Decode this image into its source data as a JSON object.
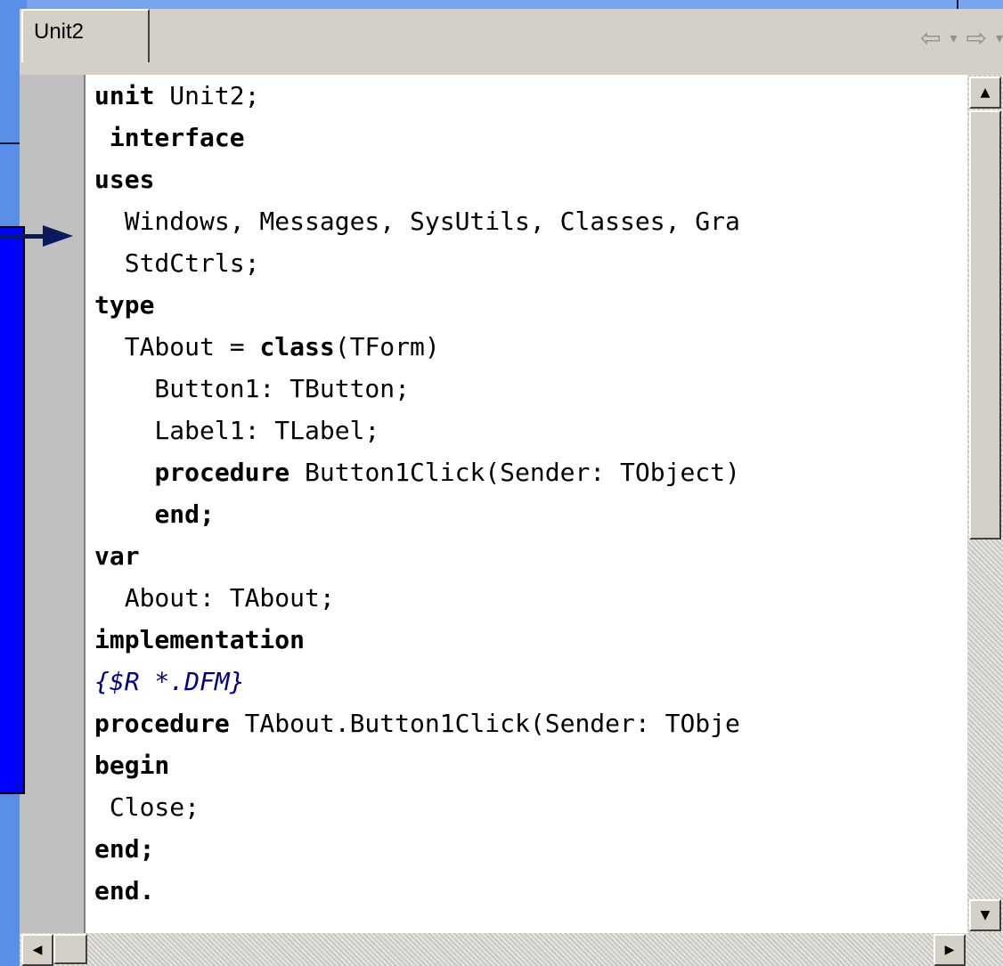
{
  "editor": {
    "tab_label": "Unit2",
    "nav": {
      "back_icon": "arrow-left-icon",
      "forward_icon": "arrow-right-icon"
    }
  },
  "code_lines": [
    [
      {
        "t": "unit",
        "k": 1
      },
      {
        "t": " Unit2;"
      }
    ],
    [
      {
        "t": " "
      },
      {
        "t": "interface",
        "k": 1
      }
    ],
    [
      {
        "t": "uses",
        "k": 1
      }
    ],
    [
      {
        "t": "  Windows, Messages, SysUtils, Classes, Gra"
      }
    ],
    [
      {
        "t": "  StdCtrls;"
      }
    ],
    [
      {
        "t": "type",
        "k": 1
      }
    ],
    [
      {
        "t": "  TAbout = "
      },
      {
        "t": "class",
        "k": 1
      },
      {
        "t": "(TForm)"
      }
    ],
    [
      {
        "t": "    Button1: TButton;"
      }
    ],
    [
      {
        "t": "    Label1: TLabel;"
      }
    ],
    [
      {
        "t": "    "
      },
      {
        "t": "procedure",
        "k": 1
      },
      {
        "t": " Button1Click(Sender: TObject)"
      }
    ],
    [
      {
        "t": "    "
      },
      {
        "t": "end;",
        "k": 1
      }
    ],
    [
      {
        "t": "var",
        "k": 1
      }
    ],
    [
      {
        "t": "  About: TAbout;"
      }
    ],
    [
      {
        "t": "implementation",
        "k": 1
      }
    ],
    [
      {
        "t": "{$R *.DFM}",
        "c": 1
      }
    ],
    [
      {
        "t": "procedure",
        "k": 1
      },
      {
        "t": " TAbout.Button1Click(Sender: TObje"
      }
    ],
    [
      {
        "t": "begin",
        "k": 1
      }
    ],
    [
      {
        "t": " Close;"
      }
    ],
    [
      {
        "t": "end;",
        "k": 1
      }
    ],
    [
      {
        "t": "end.",
        "k": 1
      }
    ]
  ],
  "colors": {
    "background": "#4a86e8",
    "panel": "#0000ff",
    "arrow": "#0a1a5c",
    "comment": "#000080"
  }
}
